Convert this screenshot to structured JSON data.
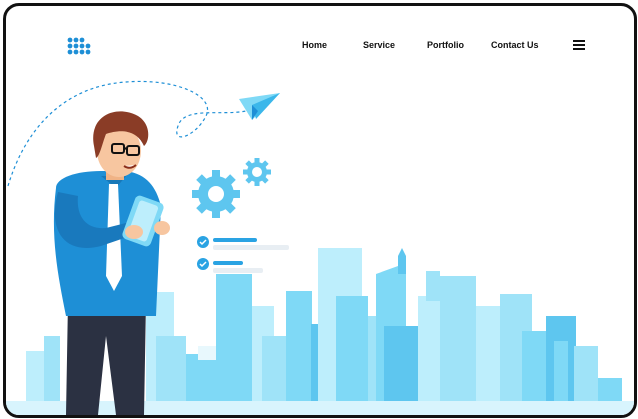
{
  "nav": {
    "items": [
      {
        "label": "Home"
      },
      {
        "label": "Service"
      },
      {
        "label": "Portfolio"
      },
      {
        "label": "Contact Us"
      }
    ]
  },
  "icons": {
    "logo": "dot-grid-logo",
    "menu": "hamburger-icon",
    "paper_plane": "paper-plane-icon",
    "gears": "gear-icon",
    "checks": "check-circle-icon"
  },
  "colors": {
    "accent": "#1e8fd6",
    "sky": "#7fd9f6",
    "light_sky": "#bdeefc",
    "frame": "#111111",
    "text": "#111111"
  }
}
